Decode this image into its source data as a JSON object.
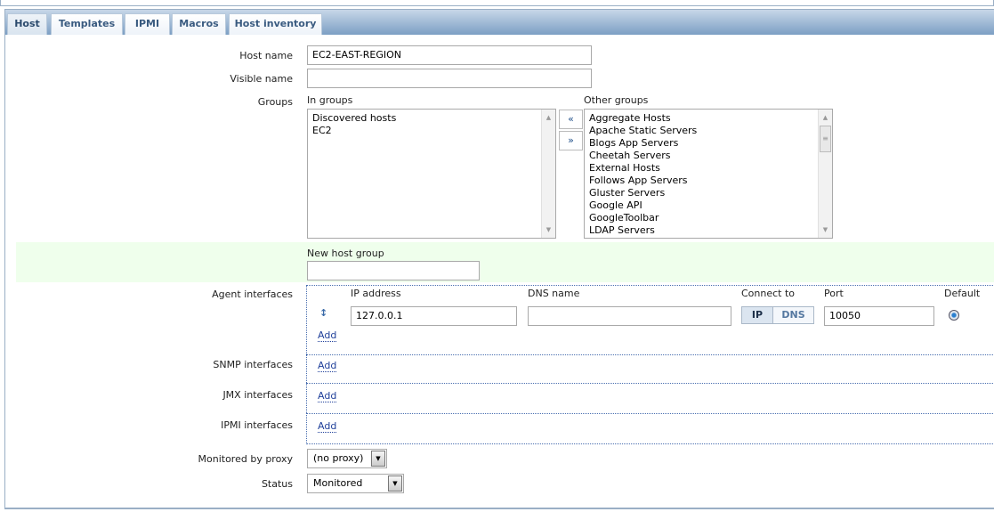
{
  "tabs": [
    "Host",
    "Templates",
    "IPMI",
    "Macros",
    "Host inventory"
  ],
  "form": {
    "host_name_label": "Host name",
    "host_name": "EC2-EAST-REGION",
    "visible_name_label": "Visible name",
    "visible_name": "",
    "groups_label": "Groups",
    "in_groups_label": "In groups",
    "other_groups_label": "Other groups",
    "in_groups": [
      "Discovered hosts",
      "EC2"
    ],
    "other_groups": [
      "Aggregate Hosts",
      "Apache Static Servers",
      "Blogs App Servers",
      "Cheetah Servers",
      "External Hosts",
      "Follows App Servers",
      "Gluster Servers",
      "Google API",
      "GoogleToolbar",
      "LDAP Servers"
    ],
    "move_left": "«",
    "move_right": "»",
    "new_group_label": "New host group",
    "new_group": "",
    "agent_label": "Agent interfaces",
    "snmp_label": "SNMP interfaces",
    "jmx_label": "JMX interfaces",
    "ipmi_label": "IPMI interfaces",
    "col_ip": "IP address",
    "col_dns": "DNS name",
    "col_connect": "Connect to",
    "col_port": "Port",
    "col_default": "Default",
    "ip": "127.0.0.1",
    "dns": "",
    "connect_ip": "IP",
    "connect_dns": "DNS",
    "port": "10050",
    "add": "Add",
    "proxy_label": "Monitored by proxy",
    "proxy": "(no proxy)",
    "status_label": "Status",
    "status": "Monitored"
  }
}
